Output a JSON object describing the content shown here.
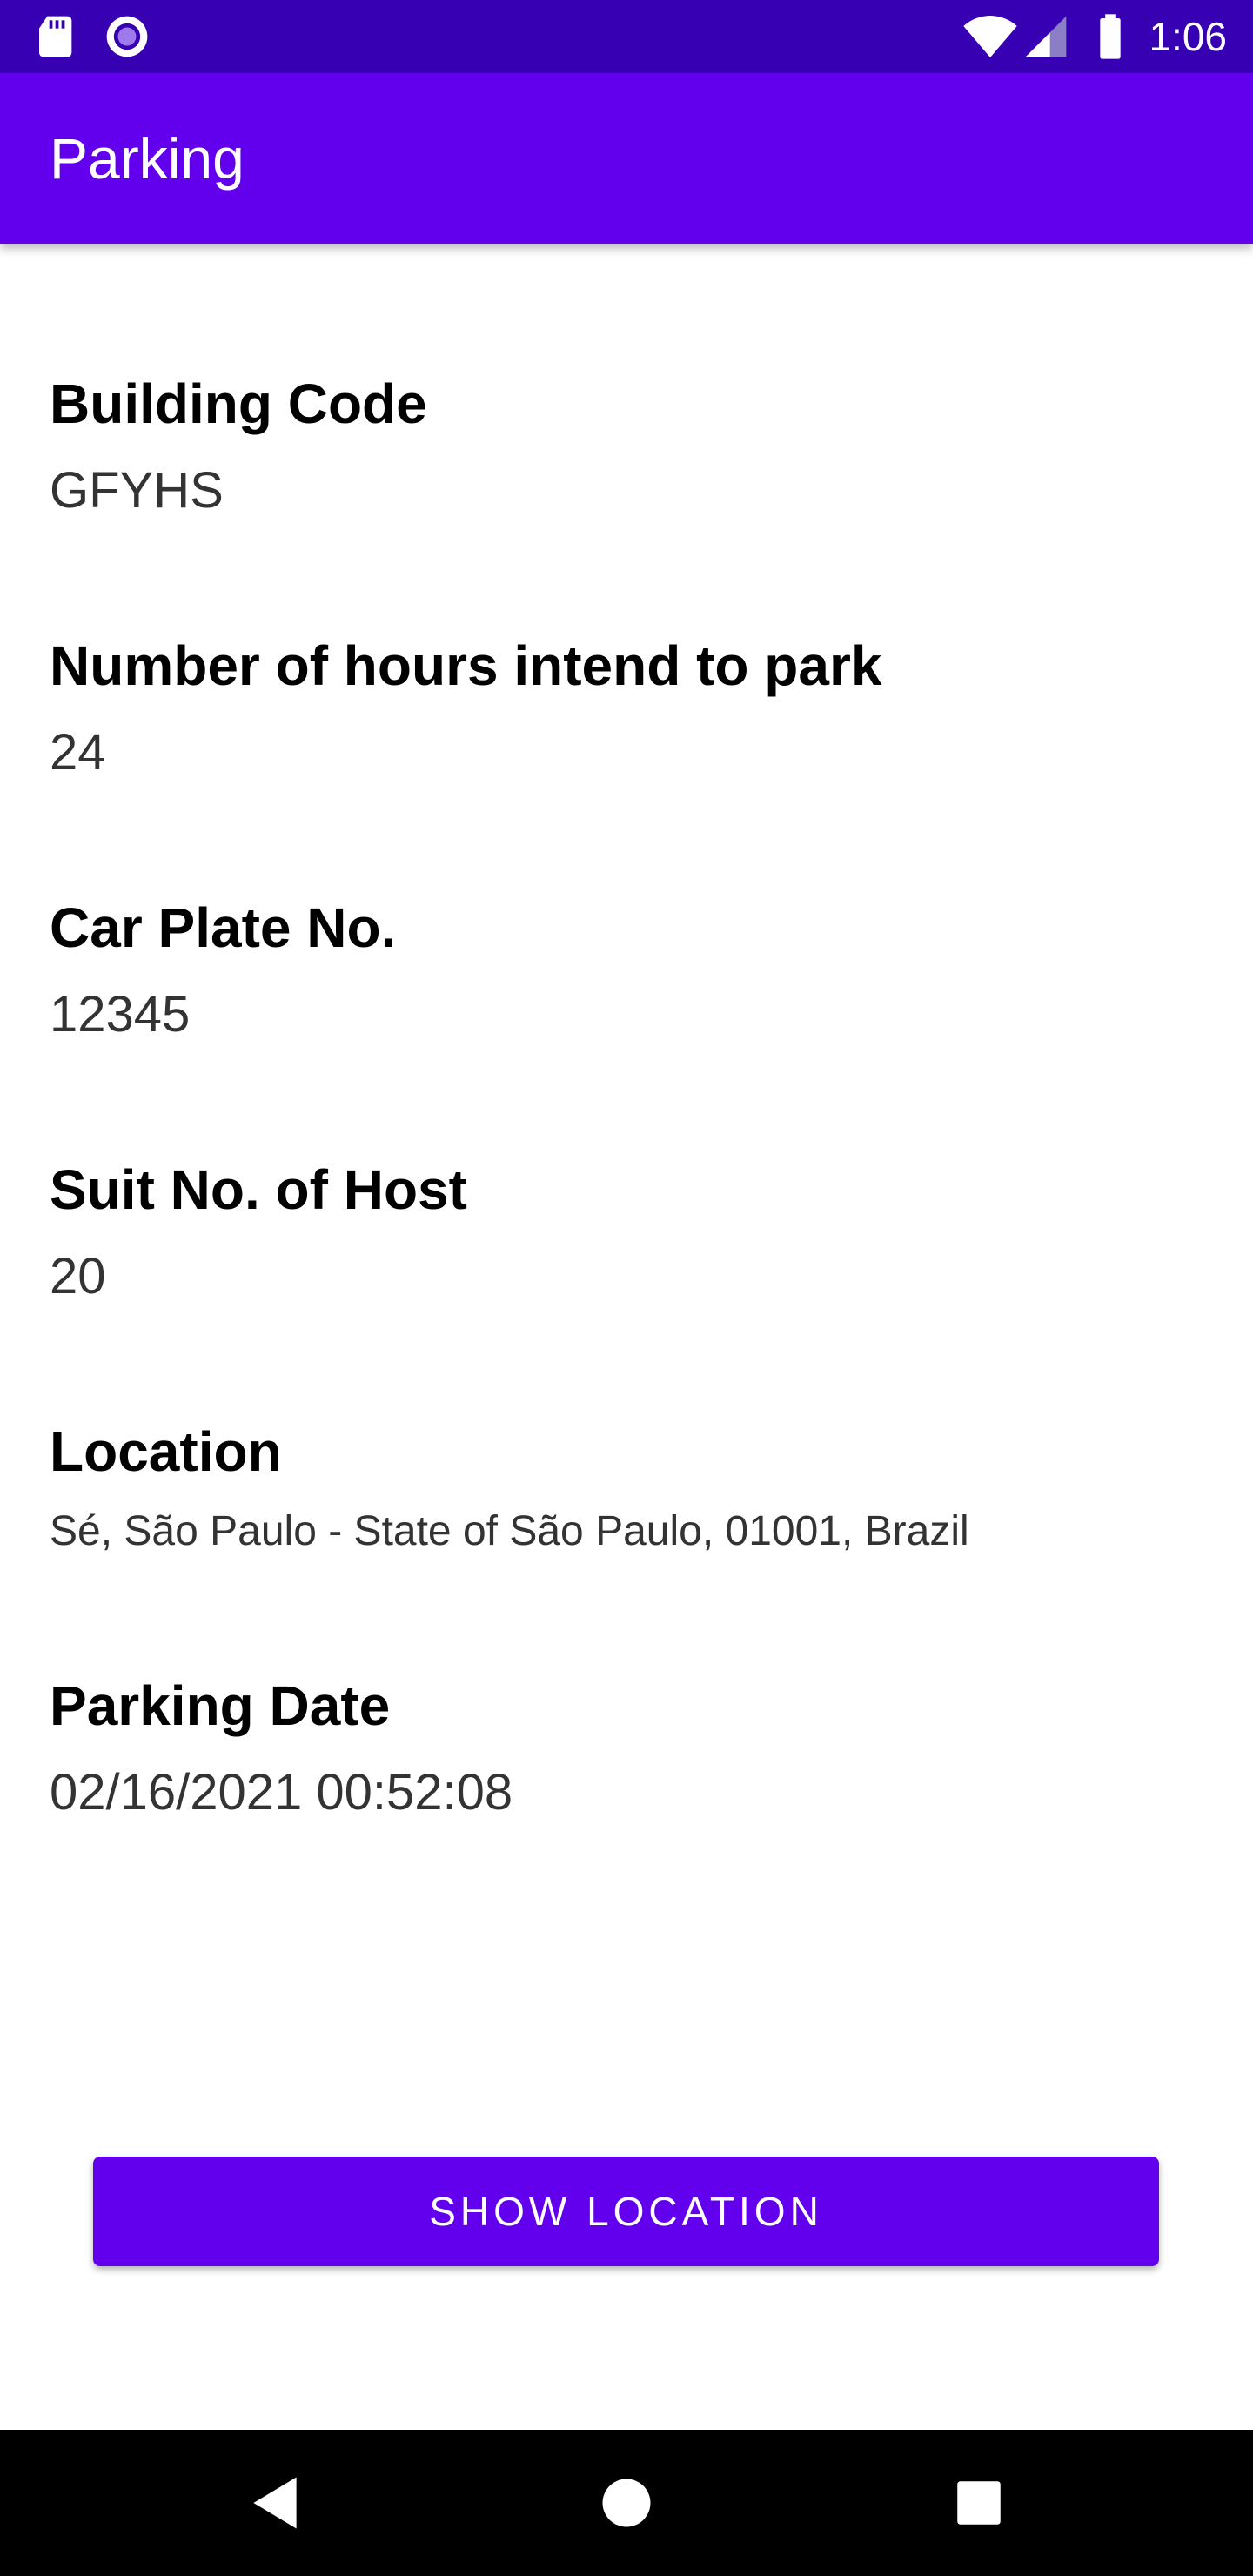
{
  "status_bar": {
    "time": "1:06",
    "left_icons": [
      "sd-card-icon",
      "record-icon"
    ],
    "right_icons": [
      "wifi-icon",
      "signal-icon",
      "battery-icon"
    ]
  },
  "app_bar": {
    "title": "Parking"
  },
  "details": {
    "building_code": {
      "label": "Building Code",
      "value": "GFYHS"
    },
    "hours": {
      "label": "Number of hours intend to park",
      "value": "24"
    },
    "car_plate": {
      "label": "Car Plate No.",
      "value": "12345"
    },
    "suit_no": {
      "label": "Suit No. of Host",
      "value": "20"
    },
    "location": {
      "label": "Location",
      "value": "Sé, São Paulo - State of São Paulo, 01001, Brazil"
    },
    "parking_date": {
      "label": "Parking Date",
      "value": "02/16/2021 00:52:08"
    }
  },
  "actions": {
    "show_location_label": "SHOW LOCATION"
  },
  "nav_bar": {
    "icons": [
      "back-icon",
      "home-icon",
      "recents-icon"
    ]
  },
  "colors": {
    "primary": "#6200ee",
    "primary_dark": "#3700b3",
    "text": "#000000",
    "value_text": "#333333"
  }
}
